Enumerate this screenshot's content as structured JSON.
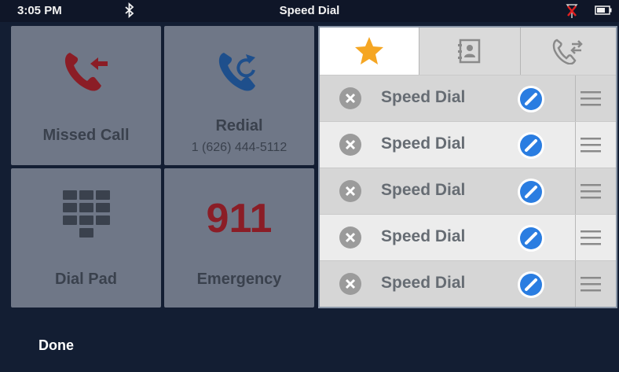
{
  "status_bar": {
    "time": "3:05 PM",
    "title": "Speed Dial",
    "icons": [
      "bluetooth-icon",
      "antenna-off-icon",
      "battery-icon"
    ]
  },
  "tiles": {
    "missed_call": {
      "label": "Missed Call",
      "icon": "missed-call-icon",
      "icon_color": "#8b1d26"
    },
    "redial": {
      "label": "Redial",
      "number": "1 (626) 444-5112",
      "icon": "redial-icon",
      "icon_color": "#1e4f8c"
    },
    "dial_pad": {
      "label": "Dial Pad",
      "icon": "dialpad-icon"
    },
    "emergency": {
      "label": "Emergency",
      "number": "911",
      "number_color": "#8b1d26"
    }
  },
  "panel": {
    "tabs": [
      {
        "icon": "star-icon",
        "active": true
      },
      {
        "icon": "contacts-icon",
        "active": false
      },
      {
        "icon": "call-transfer-icon",
        "active": false
      }
    ],
    "rows": [
      {
        "label": "Speed Dial"
      },
      {
        "label": "Speed Dial"
      },
      {
        "label": "Speed Dial"
      },
      {
        "label": "Speed Dial"
      },
      {
        "label": "Speed Dial"
      }
    ]
  },
  "footer": {
    "done_label": "Done"
  },
  "colors": {
    "background": "#131e33",
    "tile": "#6f7787",
    "accent_blue": "#2a7de1",
    "star": "#f5a623"
  }
}
